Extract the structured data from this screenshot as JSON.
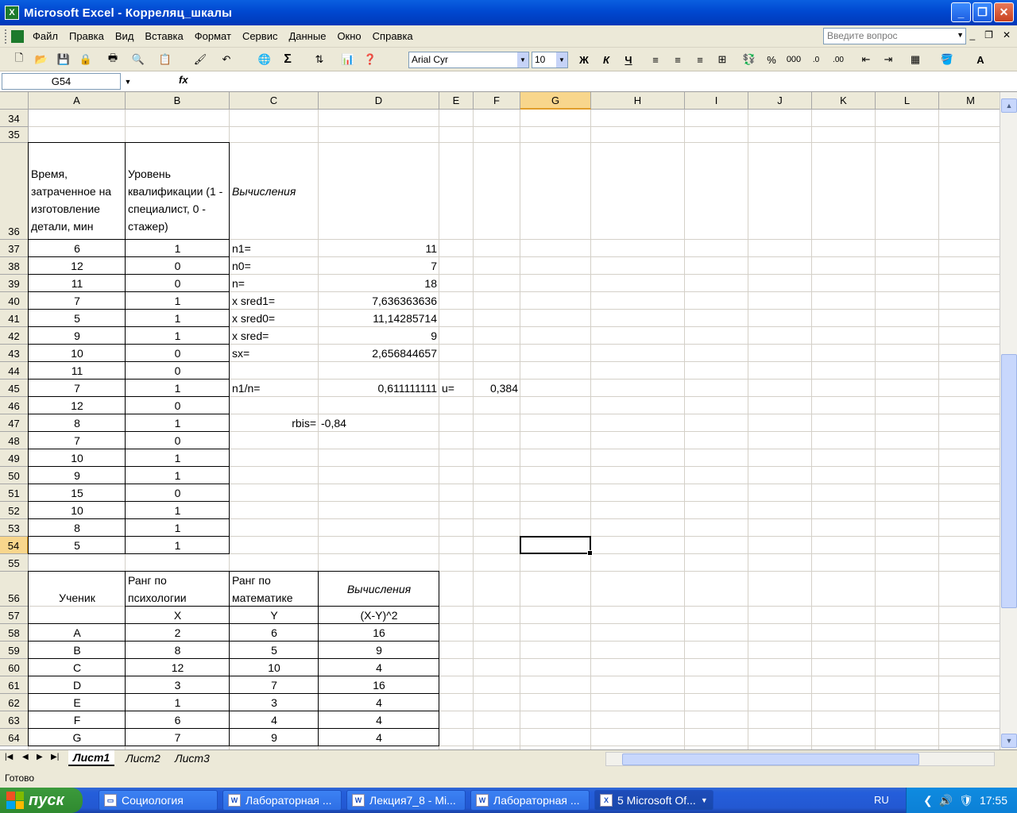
{
  "window": {
    "title": "Microsoft Excel - Корреляц_шкалы",
    "app_icon": "excel-icon"
  },
  "menu": [
    "Файл",
    "Правка",
    "Вид",
    "Вставка",
    "Формат",
    "Сервис",
    "Данные",
    "Окно",
    "Справка"
  ],
  "ask_placeholder": "Введите вопрос",
  "toolbar": {
    "font_name": "Arial Cyr",
    "font_size": "10",
    "bold": "Ж",
    "italic": "К",
    "underline": "Ч",
    "percent": "%",
    "thousands": "000",
    "sum": "Σ"
  },
  "formula_bar": {
    "name_box": "G54",
    "fx": "fx",
    "formula": ""
  },
  "columns": [
    "A",
    "B",
    "C",
    "D",
    "E",
    "F",
    "G",
    "H",
    "I",
    "J",
    "K",
    "L",
    "M"
  ],
  "selected_column": "G",
  "rows": [
    "34",
    "35",
    "36",
    "37",
    "38",
    "39",
    "40",
    "41",
    "42",
    "43",
    "44",
    "45",
    "46",
    "47",
    "48",
    "49",
    "50",
    "51",
    "52",
    "53",
    "54",
    "55",
    "56",
    "57",
    "58",
    "59",
    "60",
    "61",
    "62",
    "63",
    "64"
  ],
  "selected_row": "54",
  "table1": {
    "header_time": "Время, затраченное на изготовление детали, мин",
    "header_level": "Уровень квалификации (1 - специалист, 0 - стажер)",
    "header_calc": "Вычисления",
    "time_values": [
      "6",
      "12",
      "11",
      "7",
      "5",
      "9",
      "10",
      "11",
      "7",
      "12",
      "8",
      "7",
      "10",
      "9",
      "15",
      "10",
      "8",
      "5"
    ],
    "level_values": [
      "1",
      "0",
      "0",
      "1",
      "1",
      "1",
      "0",
      "0",
      "1",
      "0",
      "1",
      "0",
      "1",
      "1",
      "0",
      "1",
      "1",
      "1"
    ],
    "calc": [
      {
        "label": "n1=",
        "value": "11"
      },
      {
        "label": "n0=",
        "value": "7"
      },
      {
        "label": "n=",
        "value": "18"
      },
      {
        "label": "x sred1=",
        "value": "7,636363636"
      },
      {
        "label": "x sred0=",
        "value": "11,14285714"
      },
      {
        "label": "x sred=",
        "value": "9"
      },
      {
        "label": "sx=",
        "value": "2,656844657"
      }
    ],
    "n1n_label": "n1/n=",
    "n1n_value": "0,611111111",
    "u_label": "u=",
    "u_value": "0,384",
    "rbis_label": "rbis=",
    "rbis_value": "-0,84"
  },
  "table2": {
    "header_student": "Ученик",
    "header_psy": "Ранг по психологии",
    "header_math": "Ранг по математике",
    "header_calc": "Вычисления",
    "sub_x": "X",
    "sub_y": "Y",
    "sub_calc": "(X-Y)^2",
    "rows": [
      {
        "s": "A",
        "x": "2",
        "y": "6",
        "d": "16"
      },
      {
        "s": "B",
        "x": "8",
        "y": "5",
        "d": "9"
      },
      {
        "s": "C",
        "x": "12",
        "y": "10",
        "d": "4"
      },
      {
        "s": "D",
        "x": "3",
        "y": "7",
        "d": "16"
      },
      {
        "s": "E",
        "x": "1",
        "y": "3",
        "d": "4"
      },
      {
        "s": "F",
        "x": "6",
        "y": "4",
        "d": "4"
      },
      {
        "s": "G",
        "x": "7",
        "y": "9",
        "d": "4"
      }
    ]
  },
  "sheets": [
    "Лист1",
    "Лист2",
    "Лист3"
  ],
  "active_sheet": "Лист1",
  "status": "Готово",
  "taskbar": {
    "start": "пуск",
    "tasks": [
      "Социология",
      "Лабораторная ...",
      "Лекция7_8 - Mi...",
      "Лабораторная ...",
      "5 Microsoft Of..."
    ],
    "lang": "RU",
    "clock": "17:55"
  }
}
